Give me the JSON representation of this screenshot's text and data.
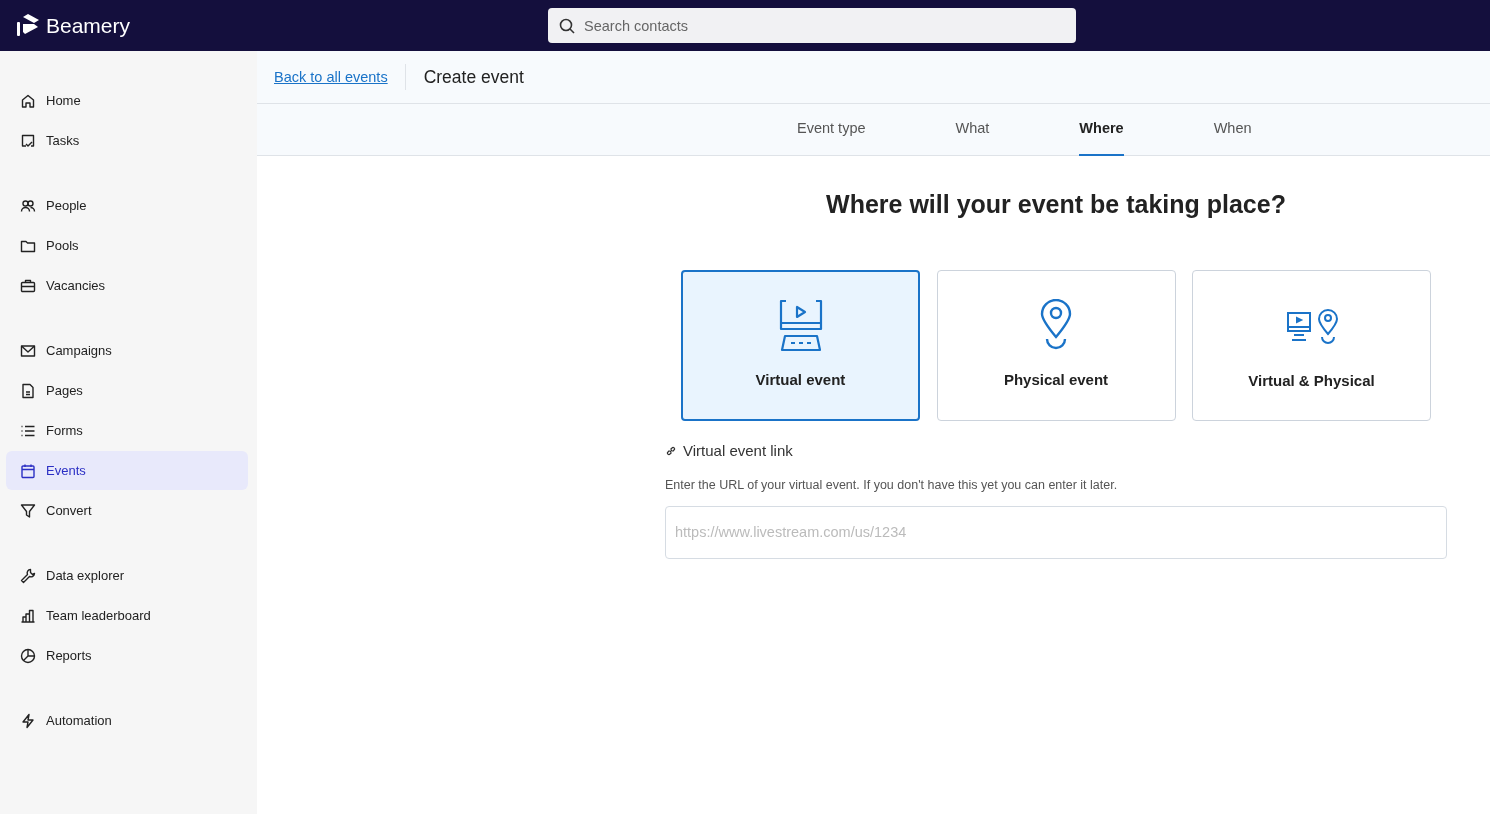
{
  "topbar": {
    "logo": "Beamery",
    "search": {
      "placeholder": "Search contacts"
    }
  },
  "sidebar": {
    "groups": [
      {
        "items": [
          {
            "label": "Home",
            "selected": false
          },
          {
            "label": "Tasks",
            "selected": false
          }
        ]
      },
      {
        "items": [
          {
            "label": "People",
            "selected": false
          },
          {
            "label": "Pools",
            "selected": false
          },
          {
            "label": "Vacancies",
            "selected": false
          }
        ]
      },
      {
        "items": [
          {
            "label": "Campaigns",
            "selected": false
          },
          {
            "label": "Pages",
            "selected": false
          },
          {
            "label": "Forms",
            "selected": false
          },
          {
            "label": "Events",
            "selected": true
          },
          {
            "label": "Convert",
            "selected": false
          }
        ]
      },
      {
        "items": [
          {
            "label": "Data explorer",
            "selected": false
          },
          {
            "label": "Team leaderboard",
            "selected": false
          },
          {
            "label": "Reports",
            "selected": false
          }
        ]
      },
      {
        "items": [
          {
            "label": "Automation",
            "selected": false
          }
        ]
      }
    ]
  },
  "header": {
    "back_link": "Back to all events",
    "title": "Create event"
  },
  "steps": [
    {
      "label": "Event type",
      "selected": false
    },
    {
      "label": "What",
      "selected": false
    },
    {
      "label": "Where",
      "selected": true
    },
    {
      "label": "When",
      "selected": false
    }
  ],
  "question": "Where will your event be taking place?",
  "options": [
    {
      "kind": "virtual",
      "label": "Virtual event",
      "selected": true
    },
    {
      "kind": "physical",
      "label": "Physical event",
      "selected": false
    },
    {
      "kind": "hybrid",
      "label": "Virtual & Physical",
      "selected": false
    }
  ],
  "link_field": {
    "label": "Virtual event link",
    "help": "Enter the URL of your virtual event. If you don't have this yet you can enter it later.",
    "placeholder": "https://www.livestream.com/us/1234"
  }
}
